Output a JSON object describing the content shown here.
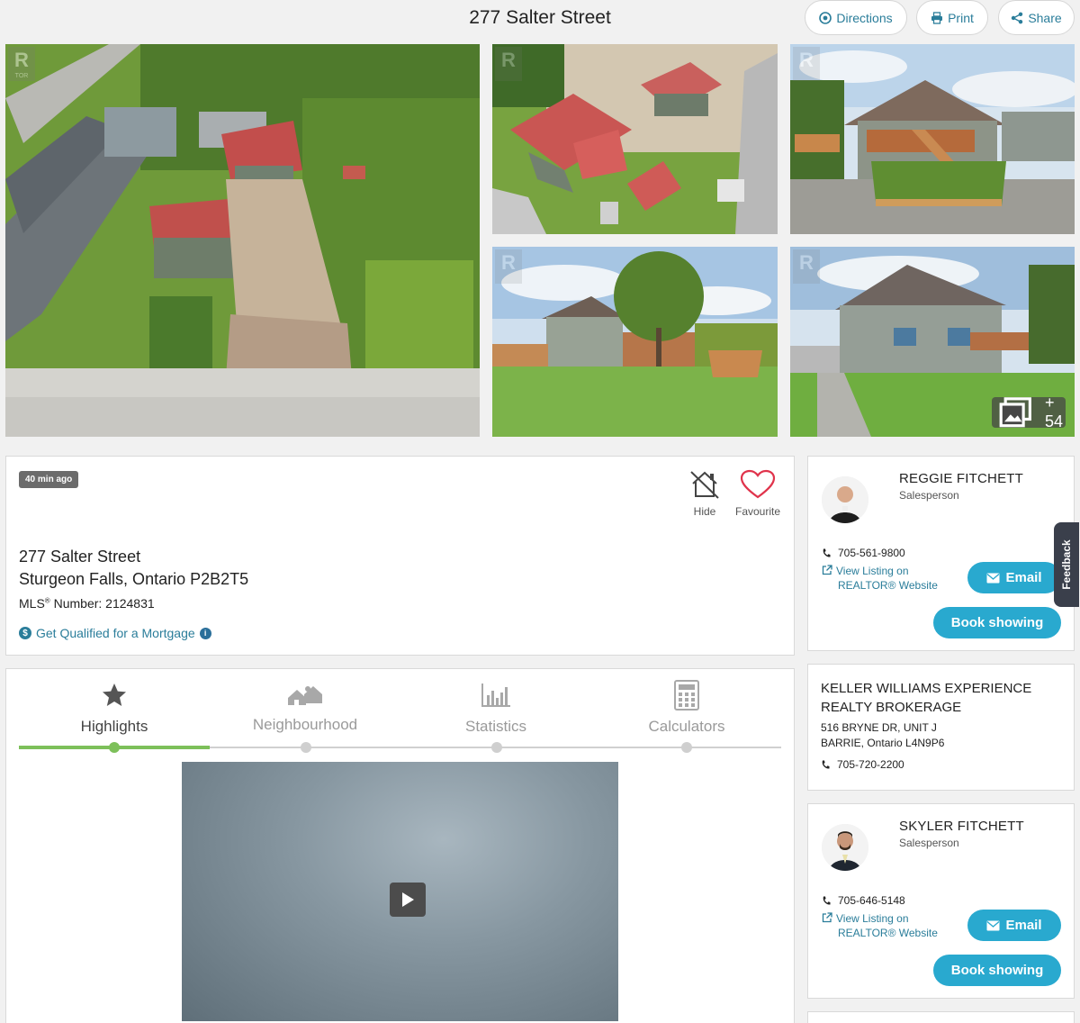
{
  "header": {
    "title": "277 Salter Street",
    "directions_label": "Directions",
    "print_label": "Print",
    "share_label": "Share"
  },
  "gallery": {
    "more_count": "+ 54",
    "watermark_text": "TOR"
  },
  "listing": {
    "age_badge": "40 min ago",
    "hide_label": "Hide",
    "favourite_label": "Favourite",
    "street": "277 Salter Street",
    "city_line": "Sturgeon Falls, Ontario P2B2T5",
    "mls_prefix": "MLS",
    "mls_rest": " Number: 2124831",
    "mortgage_link": "Get Qualified for a Mortgage"
  },
  "tabs": [
    {
      "label": "Highlights",
      "icon": "star-icon",
      "active": true
    },
    {
      "label": "Neighbourhood",
      "icon": "neighbourhood-icon",
      "active": false
    },
    {
      "label": "Statistics",
      "icon": "bar-chart-icon",
      "active": false
    },
    {
      "label": "Calculators",
      "icon": "calculator-icon",
      "active": false
    }
  ],
  "agents": [
    {
      "name": "REGGIE FITCHETT",
      "role": "Salesperson",
      "phone": "705-561-9800",
      "view_line1": "View Listing on",
      "view_line2": "REALTOR® Website",
      "email_label": "Email",
      "book_label": "Book showing"
    },
    {
      "name": "SKYLER FITCHETT",
      "role": "Salesperson",
      "phone": "705-646-5148",
      "view_line1": "View Listing on",
      "view_line2": "REALTOR® Website",
      "email_label": "Email",
      "book_label": "Book showing"
    }
  ],
  "brokerage": {
    "name_line1": "KELLER WILLIAMS EXPERIENCE",
    "name_line2": "REALTY BROKERAGE",
    "addr_line1": "516 BRYNE DR, UNIT J",
    "addr_line2": "BARRIE, Ontario L4N9P6",
    "phone": "705-720-2200"
  },
  "feedback_label": "Feedback",
  "colors": {
    "accent": "#29a9cf",
    "link": "#2a7d9a",
    "active_tab": "#7dc05a",
    "favourite": "#e0344c"
  }
}
